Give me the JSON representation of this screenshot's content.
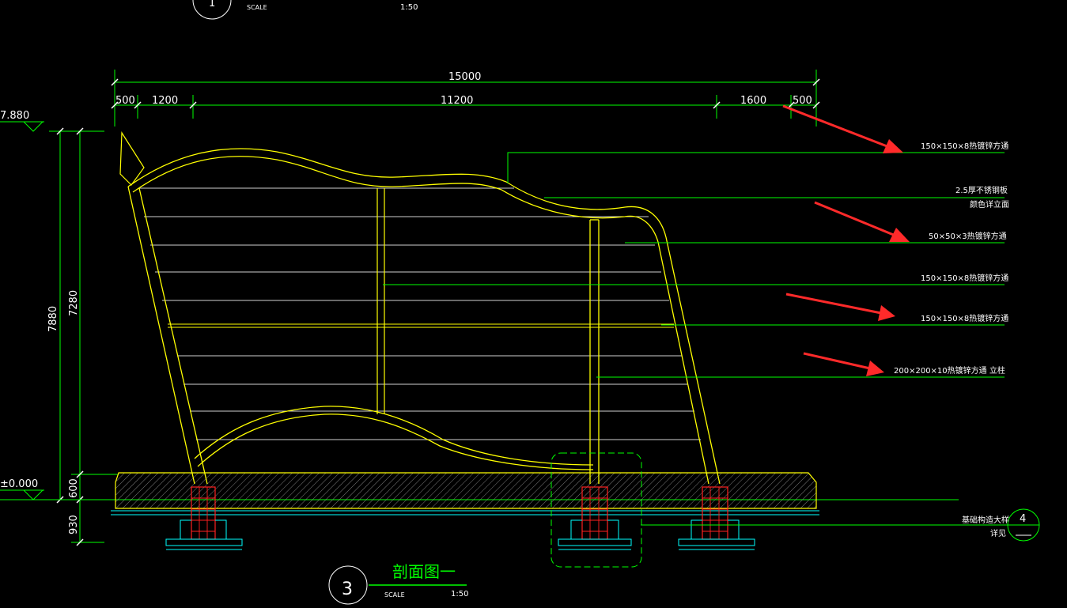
{
  "title_block_top": {
    "number": "1",
    "scale_label": "SCALE",
    "scale_value": "1:50"
  },
  "dimensions": {
    "overall": "15000",
    "segments": [
      "500",
      "1200",
      "11200",
      "1600",
      "500"
    ],
    "vertical": [
      "7880",
      "7280",
      "600",
      "930"
    ],
    "elevation_top": "7.880",
    "elevation_ground": "±0.000"
  },
  "annotations": [
    "150×150×8热镀锌方通",
    "2.5厚不锈钢板",
    "颜色详立面",
    "50×50×3热镀锌方通",
    "150×150×8热镀锌方通",
    "150×150×8热镀锌方通",
    "200×200×10热镀锌方通  立柱"
  ],
  "detail_ref": {
    "text": "基础构造大样",
    "sub": "详见",
    "number": "4"
  },
  "title_block": {
    "number": "3",
    "title": "剖面图一",
    "scale_label": "SCALE",
    "scale_value": "1:50"
  },
  "colors": {
    "background": "#000000",
    "dimension_lines": "#00ff00",
    "structure_yellow": "#ffff00",
    "highlight_arrows": "#ff2a2a",
    "foundation_red": "#ff2020",
    "cyan": "#00ffff"
  }
}
